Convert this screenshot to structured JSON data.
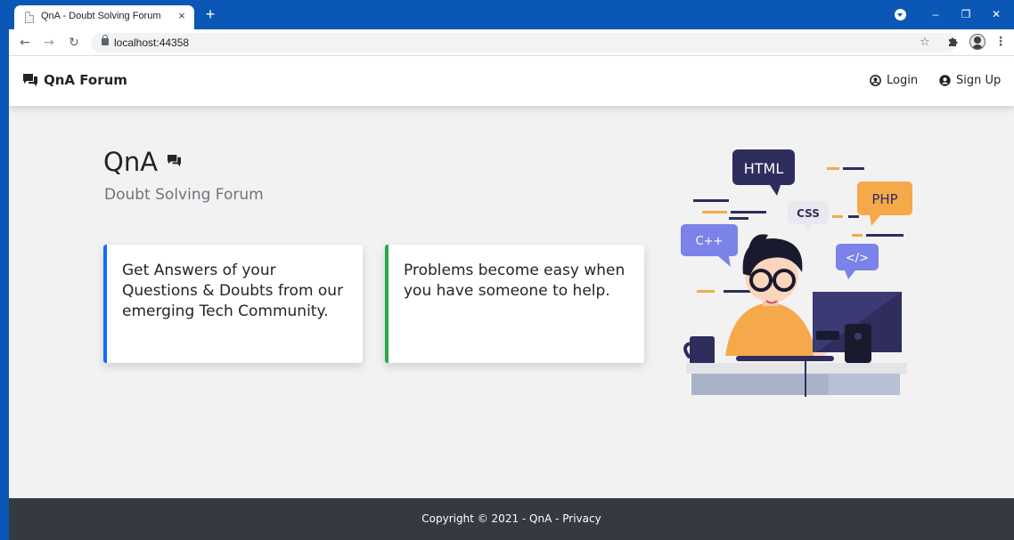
{
  "browser": {
    "tab_title": "QnA - Doubt Solving Forum",
    "tab_close": "×",
    "new_tab": "+",
    "url": "localhost:44358",
    "icons": {
      "back": "back-arrow-icon",
      "forward": "forward-arrow-icon",
      "reload": "reload-icon",
      "lock": "lock-icon",
      "bookmark": "star-icon",
      "extensions": "puzzle-icon",
      "profile": "avatar-icon",
      "menu": "kebab-menu-icon"
    },
    "window_controls": {
      "minimize": "–",
      "restore": "❐",
      "close": "✕"
    },
    "frame_color": "#0b57b5"
  },
  "navbar": {
    "brand": "QnA Forum",
    "brand_icon": "comments-icon",
    "login_label": "Login",
    "login_icon": "user-circle-icon",
    "signup_label": "Sign Up",
    "signup_icon": "user-circle-solid-icon"
  },
  "hero": {
    "title": "QnA",
    "title_icon": "comments-icon",
    "subtitle": "Doubt Solving Forum"
  },
  "cards": [
    {
      "text": "Get Answers of your Questions & Doubts from our emerging Tech Community.",
      "accent_color": "#0d6efd"
    },
    {
      "text": "Problems become easy when you have someone to help.",
      "accent_color": "#28a745"
    }
  ],
  "illustration": {
    "bubbles": [
      "HTML",
      "CSS",
      "PHP",
      "C++",
      "</>"
    ]
  },
  "footer": {
    "text": "Copyright © 2021 - QnA - Privacy"
  },
  "colors": {
    "page_bg": "#f2f2f2",
    "footer_bg": "#343a40",
    "text": "#212529",
    "muted": "#6c757d"
  }
}
